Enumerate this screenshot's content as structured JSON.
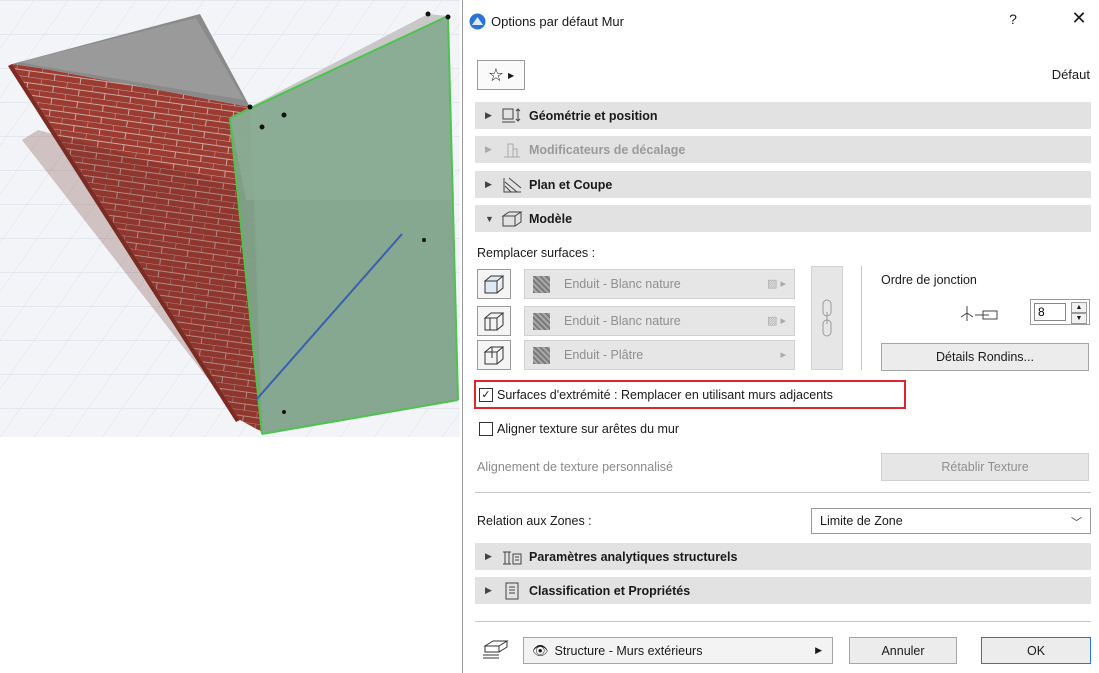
{
  "dialog": {
    "title": "Options par défaut Mur",
    "help_label": "?",
    "close_label": "✕",
    "default_label": "Défaut",
    "colors": {
      "accent": "#2a74d6",
      "highlight": "#e0242b",
      "panel_bg": "#e2e2e2"
    }
  },
  "panels": {
    "geometry": "Géométrie et position",
    "offset": "Modificateurs de décalage",
    "plan": "Plan et Coupe",
    "model": "Modèle",
    "analytics": "Paramètres analytiques structurels",
    "classification": "Classification et Propriétés"
  },
  "model": {
    "replace_surfaces_label": "Remplacer surfaces :",
    "surfaces": [
      {
        "name": "Enduit - Blanc nature",
        "icon": "outside-face-icon"
      },
      {
        "name": "Enduit - Blanc nature",
        "icon": "edge-face-icon"
      },
      {
        "name": "Enduit - Plâtre",
        "icon": "inside-face-icon"
      }
    ],
    "junction_order_label": "Ordre de jonction",
    "junction_order_value": "8",
    "log_details_button": "Détails Rondins...",
    "end_surfaces_checkbox": {
      "label": "Surfaces d'extrémité : Remplacer en utilisant murs adjacents",
      "checked": true
    },
    "align_texture_checkbox": {
      "label": "Aligner texture sur arêtes du mur",
      "checked": false
    },
    "custom_texture_label": "Alignement de texture personnalisé",
    "reset_texture_button": "Rétablir Texture"
  },
  "zones": {
    "label": "Relation aux Zones :",
    "selected": "Limite de Zone"
  },
  "footer": {
    "preset": "Structure - Murs extérieurs",
    "cancel": "Annuler",
    "ok": "OK"
  }
}
